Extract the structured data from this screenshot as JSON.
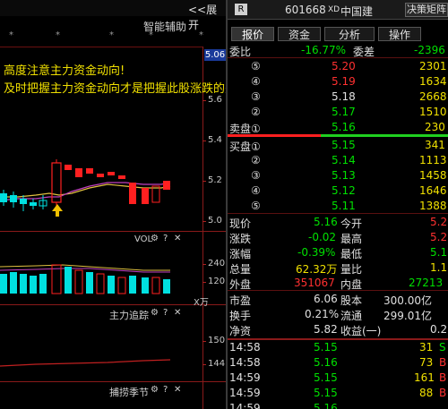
{
  "left": {
    "expand_label": "<<展开",
    "panel_title": "智能辅助",
    "stars": [
      "*",
      "*",
      "*",
      "*",
      "*"
    ],
    "price_axis": [
      "5.6",
      "5.4",
      "5.2",
      "5.0"
    ],
    "price_highlight": "5.06",
    "annotation_line1": "高度注意主力资金动向!",
    "annotation_line2": "及时把握主力资金动向才是把握此股涨跌的关键!",
    "vol_label": "VOL",
    "vol_axis": [
      "240",
      "120",
      "X万"
    ],
    "main_track_label": "主力追踪",
    "capture_label": "捕捞季节",
    "capture_axis": [
      "150",
      "144"
    ],
    "icons": {
      "gear": "gear-icon",
      "help": "help-icon",
      "close": "close-icon"
    }
  },
  "right": {
    "badge": "R",
    "code": "601668",
    "xd": "XD",
    "name": "中国建",
    "matrix_button": "决策矩阵",
    "tabs": [
      "报价",
      "资金",
      "分析",
      "操作"
    ],
    "weibi": {
      "label": "委比",
      "value": "-16.77%",
      "label2": "委差",
      "value2": "-2396"
    },
    "sell": [
      {
        "label": "⑤",
        "price": "5.20",
        "vol": "2301"
      },
      {
        "label": "④",
        "price": "5.19",
        "vol": "1634"
      },
      {
        "label": "③",
        "price": "5.18",
        "vol": "2668"
      },
      {
        "label": "②",
        "price": "5.17",
        "vol": "1510"
      },
      {
        "label": "卖盘①",
        "price": "5.16",
        "vol": "230"
      }
    ],
    "buy": [
      {
        "label": "买盘①",
        "price": "5.15",
        "vol": "341"
      },
      {
        "label": "②",
        "price": "5.14",
        "vol": "1113"
      },
      {
        "label": "③",
        "price": "5.13",
        "vol": "1458"
      },
      {
        "label": "④",
        "price": "5.12",
        "vol": "1646"
      },
      {
        "label": "⑤",
        "price": "5.11",
        "vol": "1388"
      }
    ],
    "stats": [
      {
        "l1": "现价",
        "v1": "5.16",
        "l2": "今开",
        "v2": "5.2"
      },
      {
        "l1": "涨跌",
        "v1": "-0.02",
        "l2": "最高",
        "v2": "5.2"
      },
      {
        "l1": "涨幅",
        "v1": "-0.39%",
        "l2": "最低",
        "v2": "5.1"
      },
      {
        "l1": "总量",
        "v1": "62.32万",
        "l2": "量比",
        "v2": "1.1"
      },
      {
        "l1": "外盘",
        "v1": "351067",
        "l2": "内盘",
        "v2": "27213"
      }
    ],
    "stats2": [
      {
        "l1": "市盈",
        "v1": "6.06",
        "l2": "股本",
        "v2": "300.00亿"
      },
      {
        "l1": "换手",
        "v1": "0.21%",
        "l2": "流通",
        "v2": "299.01亿"
      },
      {
        "l1": "净资",
        "v1": "5.82",
        "l2": "收益(一)",
        "v2": "0.21"
      }
    ],
    "trades": [
      {
        "time": "14:58",
        "price": "5.15",
        "vol": "31",
        "flag": "S"
      },
      {
        "time": "14:58",
        "price": "5.16",
        "vol": "73",
        "flag": "B"
      },
      {
        "time": "14:59",
        "price": "5.15",
        "vol": "161",
        "flag": "B"
      },
      {
        "time": "14:59",
        "price": "5.15",
        "vol": "88",
        "flag": "B"
      },
      {
        "time": "14:59",
        "price": "5.16",
        "vol": "",
        "flag": ""
      }
    ]
  }
}
